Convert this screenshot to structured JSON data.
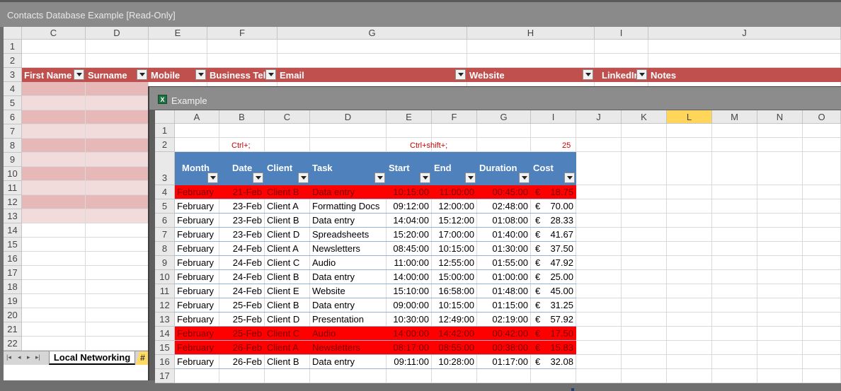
{
  "app": {
    "title": "Contacts Database Example  [Read-Only]"
  },
  "back_sheet": {
    "columns": [
      "C",
      "D",
      "E",
      "F",
      "G",
      "H",
      "I",
      "J"
    ],
    "rows": [
      "1",
      "2",
      "3",
      "4",
      "5",
      "6",
      "7",
      "8",
      "9",
      "10",
      "11",
      "12",
      "13",
      "14",
      "15",
      "16",
      "17",
      "18",
      "19",
      "20",
      "21",
      "22"
    ],
    "headers": [
      "First Name",
      "Surname",
      "Mobile",
      "Business Tel",
      "Email",
      "Website",
      "LinkedIn",
      "Notes"
    ],
    "tabs": [
      "Local Networking",
      "#"
    ]
  },
  "window": {
    "title": "Example",
    "columns": [
      "A",
      "B",
      "C",
      "D",
      "E",
      "F",
      "G",
      "I",
      "J",
      "K",
      "L",
      "M",
      "N",
      "O"
    ],
    "rows": [
      "1",
      "2",
      "3",
      "4",
      "5",
      "6",
      "7",
      "8",
      "9",
      "10",
      "11",
      "12",
      "13",
      "14",
      "15",
      "16",
      "17"
    ],
    "row2": {
      "b": "Ctrl+;",
      "ef": "Ctrl+shift+;",
      "i": "25"
    },
    "table_headers": [
      "Month",
      "Date",
      "Client",
      "Task",
      "Start",
      "End",
      "Duration",
      "Cost"
    ],
    "data": [
      {
        "month": "February",
        "date": "21-Feb",
        "client": "Client B",
        "task": "Data entry",
        "start": "10:15:00",
        "end": "11:00:00",
        "duration": "00:45:00",
        "cur": "€",
        "cost": "18.75",
        "highlight": true
      },
      {
        "month": "February",
        "date": "23-Feb",
        "client": "Client A",
        "task": "Formatting Docs",
        "start": "09:12:00",
        "end": "12:00:00",
        "duration": "02:48:00",
        "cur": "€",
        "cost": "70.00",
        "highlight": false
      },
      {
        "month": "February",
        "date": "23-Feb",
        "client": "Client B",
        "task": "Data entry",
        "start": "14:04:00",
        "end": "15:12:00",
        "duration": "01:08:00",
        "cur": "€",
        "cost": "28.33",
        "highlight": false
      },
      {
        "month": "February",
        "date": "23-Feb",
        "client": "Client D",
        "task": "Spreadsheets",
        "start": "15:20:00",
        "end": "17:00:00",
        "duration": "01:40:00",
        "cur": "€",
        "cost": "41.67",
        "highlight": false
      },
      {
        "month": "February",
        "date": "24-Feb",
        "client": "Client A",
        "task": "Newsletters",
        "start": "08:45:00",
        "end": "10:15:00",
        "duration": "01:30:00",
        "cur": "€",
        "cost": "37.50",
        "highlight": false
      },
      {
        "month": "February",
        "date": "24-Feb",
        "client": "Client C",
        "task": "Audio",
        "start": "11:00:00",
        "end": "12:55:00",
        "duration": "01:55:00",
        "cur": "€",
        "cost": "47.92",
        "highlight": false
      },
      {
        "month": "February",
        "date": "24-Feb",
        "client": "Client B",
        "task": "Data entry",
        "start": "14:00:00",
        "end": "15:00:00",
        "duration": "01:00:00",
        "cur": "€",
        "cost": "25.00",
        "highlight": false
      },
      {
        "month": "February",
        "date": "24-Feb",
        "client": "Client E",
        "task": "Website",
        "start": "15:10:00",
        "end": "16:58:00",
        "duration": "01:48:00",
        "cur": "€",
        "cost": "45.00",
        "highlight": false
      },
      {
        "month": "February",
        "date": "25-Feb",
        "client": "Client B",
        "task": "Data entry",
        "start": "09:00:00",
        "end": "10:15:00",
        "duration": "01:15:00",
        "cur": "€",
        "cost": "31.25",
        "highlight": false
      },
      {
        "month": "February",
        "date": "25-Feb",
        "client": "Client D",
        "task": "Presentation",
        "start": "10:30:00",
        "end": "12:49:00",
        "duration": "02:19:00",
        "cur": "€",
        "cost": "57.92",
        "highlight": false
      },
      {
        "month": "February",
        "date": "25-Feb",
        "client": "Client C",
        "task": "Audio",
        "start": "14:00:00",
        "end": "14:42:00",
        "duration": "00:42:00",
        "cur": "€",
        "cost": "17.50",
        "highlight": true
      },
      {
        "month": "February",
        "date": "26-Feb",
        "client": "Client A",
        "task": "Newsletters",
        "start": "08:17:00",
        "end": "08:55:00",
        "duration": "00:38:00",
        "cur": "€",
        "cost": "15.83",
        "highlight": true
      },
      {
        "month": "February",
        "date": "26-Feb",
        "client": "Client B",
        "task": "Data entry",
        "start": "09:11:00",
        "end": "10:28:00",
        "duration": "01:17:00",
        "cur": "€",
        "cost": "32.08",
        "highlight": false
      }
    ]
  }
}
